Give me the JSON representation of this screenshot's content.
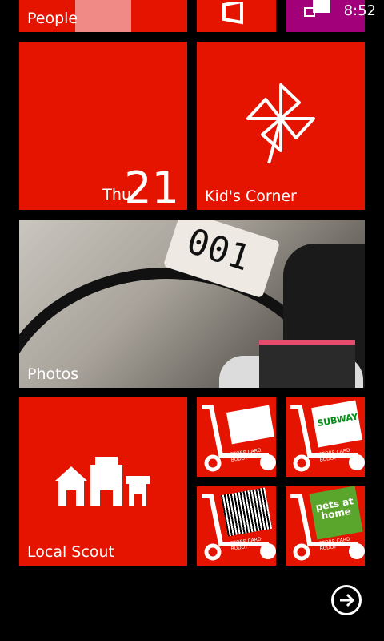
{
  "status_bar": {
    "time": "8:52"
  },
  "tiles": {
    "people": {
      "label": "People"
    },
    "calendar": {
      "day": "Thu",
      "date": "21"
    },
    "kids_corner": {
      "label": "Kid's Corner"
    },
    "photos": {
      "label": "Photos",
      "bib_number": "001"
    },
    "local_scout": {
      "label": "Local Scout"
    },
    "store_card_buddy": {
      "caption": "STORE CARD BUDDY",
      "brands": [
        "SUBWAY",
        "pets at home"
      ]
    }
  },
  "colors": {
    "accent": "#e51400",
    "purple": "#a2007b",
    "background": "#000000"
  },
  "icons": [
    "office-icon",
    "pinwheel-icon",
    "local-scout-buildings-icon",
    "cart-icon",
    "next-arrow-icon"
  ]
}
